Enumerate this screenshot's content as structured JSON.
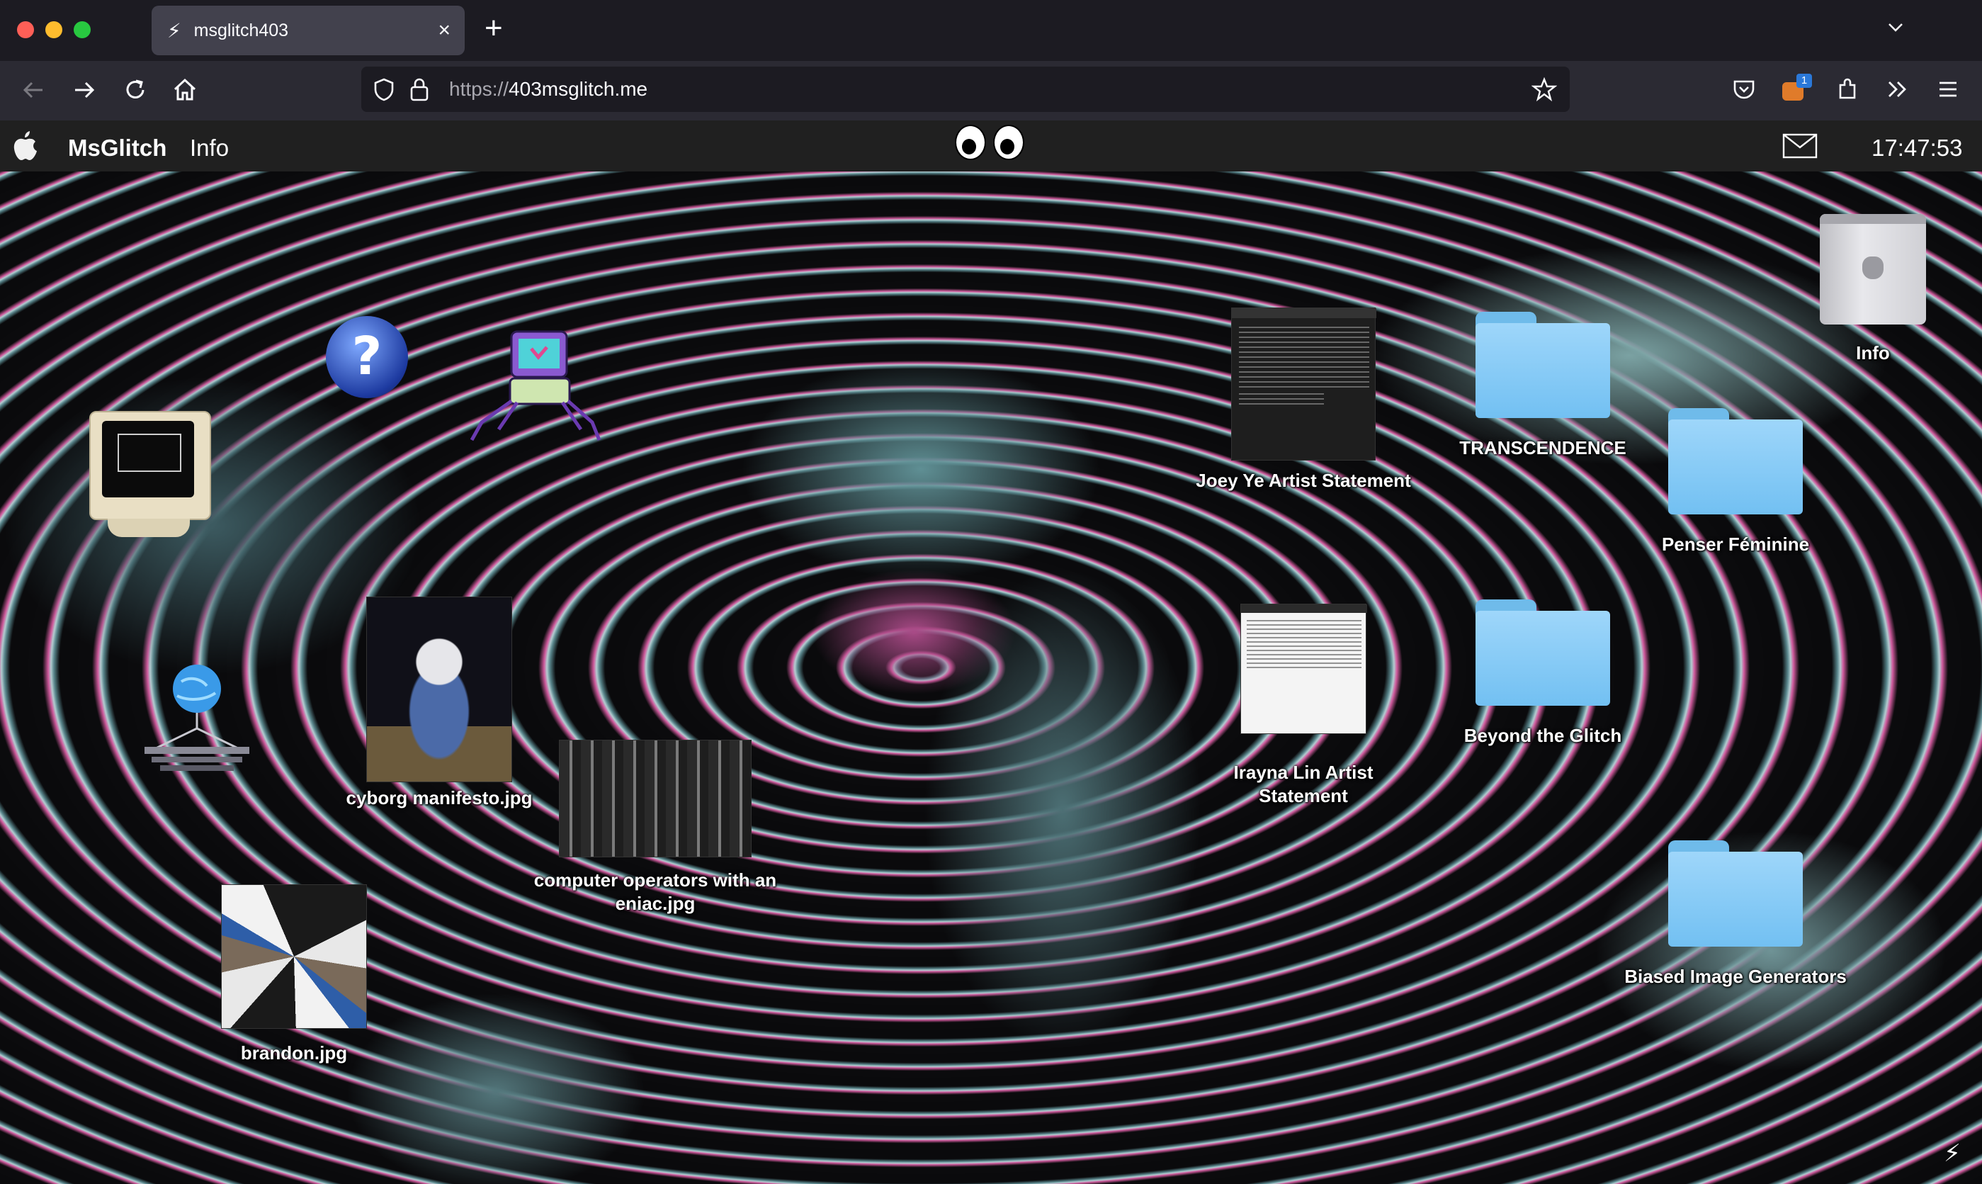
{
  "browser": {
    "tab_title": "msglitch403",
    "tab_close": "×",
    "new_tab": "+",
    "url_scheme": "https://",
    "url_host": "403msglitch.me",
    "extension_badge": "1"
  },
  "menubar": {
    "brand": "MsGlitch",
    "info": "Info",
    "clock": "17:47:53"
  },
  "desktop": {
    "joey": "Joey Ye Artist Statement",
    "irayna": "Irayna Lin Artist Statement",
    "transcendence": "TRANSCENDENCE",
    "penser": "Penser Féminine",
    "beyond": "Beyond the Glitch",
    "biased": "Biased Image Generators",
    "info": "Info",
    "cyborg": "cyborg manifesto.jpg",
    "eniac": "computer operators with an eniac.jpg",
    "brandon": "brandon.jpg"
  },
  "colors": {
    "tabbar": "#1c1b22",
    "toolbar": "#2b2a33",
    "menubar": "#202020",
    "folder": "#8ccff7"
  },
  "icons": [
    "lightning-icon",
    "back-arrow-icon",
    "forward-arrow-icon",
    "reload-icon",
    "home-icon",
    "shield-icon",
    "lock-icon",
    "star-icon",
    "pocket-icon",
    "extension-icon",
    "overflow-icon",
    "hamburger-icon",
    "apple-icon",
    "eyes-icon",
    "mail-icon",
    "folder-icon",
    "question-globe-icon",
    "retro-computer-icon",
    "spider-robot-icon",
    "globe-network-icon",
    "mac-pro-icon"
  ]
}
